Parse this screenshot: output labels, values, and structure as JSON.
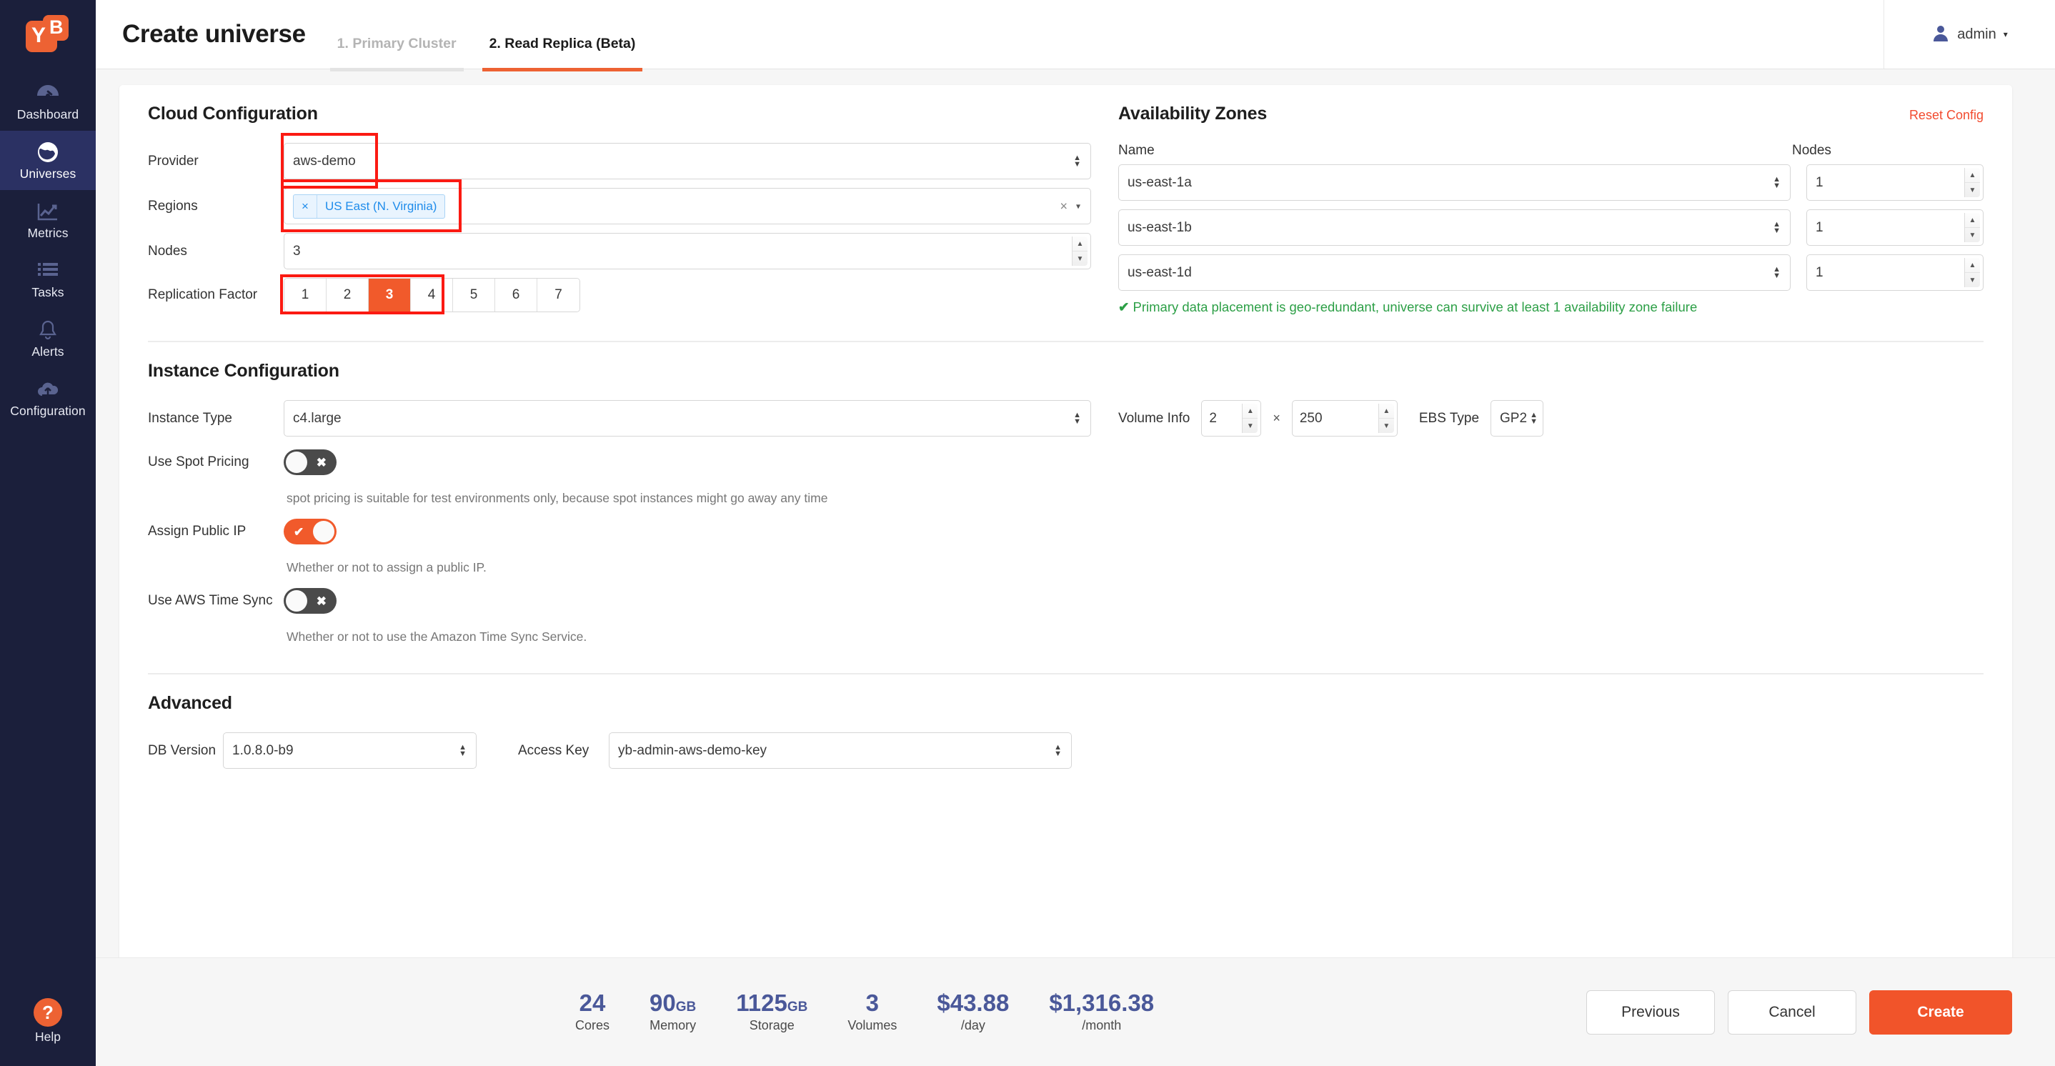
{
  "sidebar": {
    "logo": {
      "left": "Y",
      "right": "B"
    },
    "items": [
      {
        "label": "Dashboard",
        "icon": "dashboard-icon",
        "active": false
      },
      {
        "label": "Universes",
        "icon": "globe-icon",
        "active": true
      },
      {
        "label": "Metrics",
        "icon": "chart-line-icon",
        "active": false
      },
      {
        "label": "Tasks",
        "icon": "list-icon",
        "active": false
      },
      {
        "label": "Alerts",
        "icon": "bell-icon",
        "active": false
      },
      {
        "label": "Configuration",
        "icon": "cloud-upload-icon",
        "active": false
      }
    ],
    "help": {
      "label": "Help",
      "glyph": "?"
    }
  },
  "header": {
    "title": "Create universe",
    "tabs": [
      {
        "label": "1. Primary Cluster",
        "active": false
      },
      {
        "label": "2. Read Replica (Beta)",
        "active": true
      }
    ],
    "user": {
      "name": "admin",
      "caret": "▾",
      "icon": "user-avatar-icon"
    }
  },
  "cloud_config": {
    "title": "Cloud Configuration",
    "provider": {
      "label": "Provider",
      "value": "aws-demo"
    },
    "regions": {
      "label": "Regions",
      "tokens": [
        {
          "remove": "×",
          "label": "US East (N. Virginia)"
        }
      ],
      "clear": "×",
      "caret": "▾"
    },
    "nodes": {
      "label": "Nodes",
      "value": "3"
    },
    "replication_factor": {
      "label": "Replication Factor",
      "options": [
        "1",
        "2",
        "3",
        "4",
        "5",
        "6",
        "7"
      ],
      "selected": "3"
    }
  },
  "availability_zones": {
    "title": "Availability Zones",
    "reset_label": "Reset Config",
    "col_name": "Name",
    "col_nodes": "Nodes",
    "rows": [
      {
        "name": "us-east-1a",
        "nodes": "1"
      },
      {
        "name": "us-east-1b",
        "nodes": "1"
      },
      {
        "name": "us-east-1d",
        "nodes": "1"
      }
    ],
    "note": "Primary data placement is geo-redundant, universe can survive at least 1 availability zone failure",
    "note_check": "✔"
  },
  "instance_config": {
    "title": "Instance Configuration",
    "instance_type": {
      "label": "Instance Type",
      "value": "c4.large"
    },
    "volume_info": {
      "label": "Volume Info",
      "count": "2",
      "times": "×",
      "size": "250"
    },
    "ebs_type": {
      "label": "EBS Type",
      "value": "GP2"
    },
    "spot_pricing": {
      "label": "Use Spot Pricing",
      "state": "off",
      "glyph": "✖",
      "helper": "spot pricing is suitable for test environments only, because spot instances might go away any time"
    },
    "assign_public_ip": {
      "label": "Assign Public IP",
      "state": "on",
      "glyph": "✔",
      "helper": "Whether or not to assign a public IP."
    },
    "aws_time_sync": {
      "label": "Use AWS Time Sync",
      "state": "off",
      "glyph": "✖",
      "helper": "Whether or not to use the Amazon Time Sync Service."
    }
  },
  "advanced": {
    "title": "Advanced",
    "db_version": {
      "label": "DB Version",
      "value": "1.0.8.0-b9"
    },
    "access_key": {
      "label": "Access Key",
      "value": "yb-admin-aws-demo-key"
    }
  },
  "footer": {
    "stats": [
      {
        "value": "24",
        "unit": "",
        "label": "Cores"
      },
      {
        "value": "90",
        "unit": "GB",
        "label": "Memory"
      },
      {
        "value": "1125",
        "unit": "GB",
        "label": "Storage"
      },
      {
        "value": "3",
        "unit": "",
        "label": "Volumes"
      },
      {
        "value": "$43.88",
        "unit": "",
        "label": "/day"
      },
      {
        "value": "$1,316.38",
        "unit": "",
        "label": "/month"
      }
    ],
    "buttons": {
      "previous": "Previous",
      "cancel": "Cancel",
      "create": "Create"
    }
  },
  "colors": {
    "brand_orange": "#f1542a",
    "sidebar_navy": "#1b1f3b",
    "success_green": "#2c9f46",
    "highlight_red": "#fb1a12",
    "stat_blue": "#4a5899",
    "token_blue": "#1f8ceb"
  }
}
